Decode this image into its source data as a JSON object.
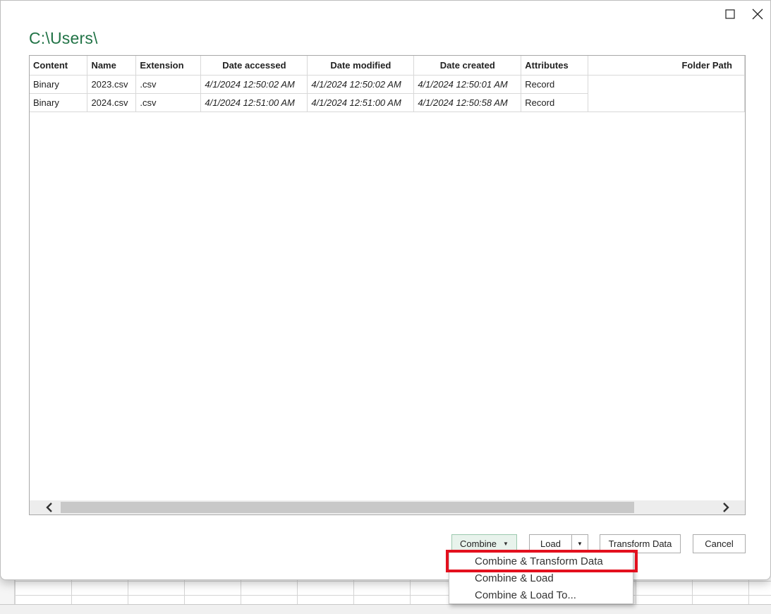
{
  "window": {
    "title": "C:\\Users\\",
    "maximize_icon": "maximize-icon",
    "close_icon": "close-icon"
  },
  "table": {
    "columns": [
      "Content",
      "Name",
      "Extension",
      "Date accessed",
      "Date modified",
      "Date created",
      "Attributes",
      "Folder Path"
    ],
    "rows": [
      [
        "Binary",
        "2023.csv",
        ".csv",
        "4/1/2024 12:50:02 AM",
        "4/1/2024 12:50:02 AM",
        "4/1/2024 12:50:01 AM",
        "Record",
        ""
      ],
      [
        "Binary",
        "2024.csv",
        ".csv",
        "4/1/2024 12:51:00 AM",
        "4/1/2024 12:51:00 AM",
        "4/1/2024 12:50:58 AM",
        "Record",
        ""
      ]
    ]
  },
  "scrollbar": {
    "left_icon": "chevron-left-icon",
    "right_icon": "chevron-right-icon"
  },
  "buttons": {
    "combine": "Combine",
    "load": "Load",
    "transform": "Transform Data",
    "cancel": "Cancel"
  },
  "combine_menu": {
    "items": [
      "Combine & Transform Data",
      "Combine & Load",
      "Combine & Load To..."
    ],
    "highlighted_index": 0,
    "highlight_color": "#e3101e"
  },
  "colors": {
    "title": "#217346",
    "combine_bg": "#e8f3ec"
  }
}
